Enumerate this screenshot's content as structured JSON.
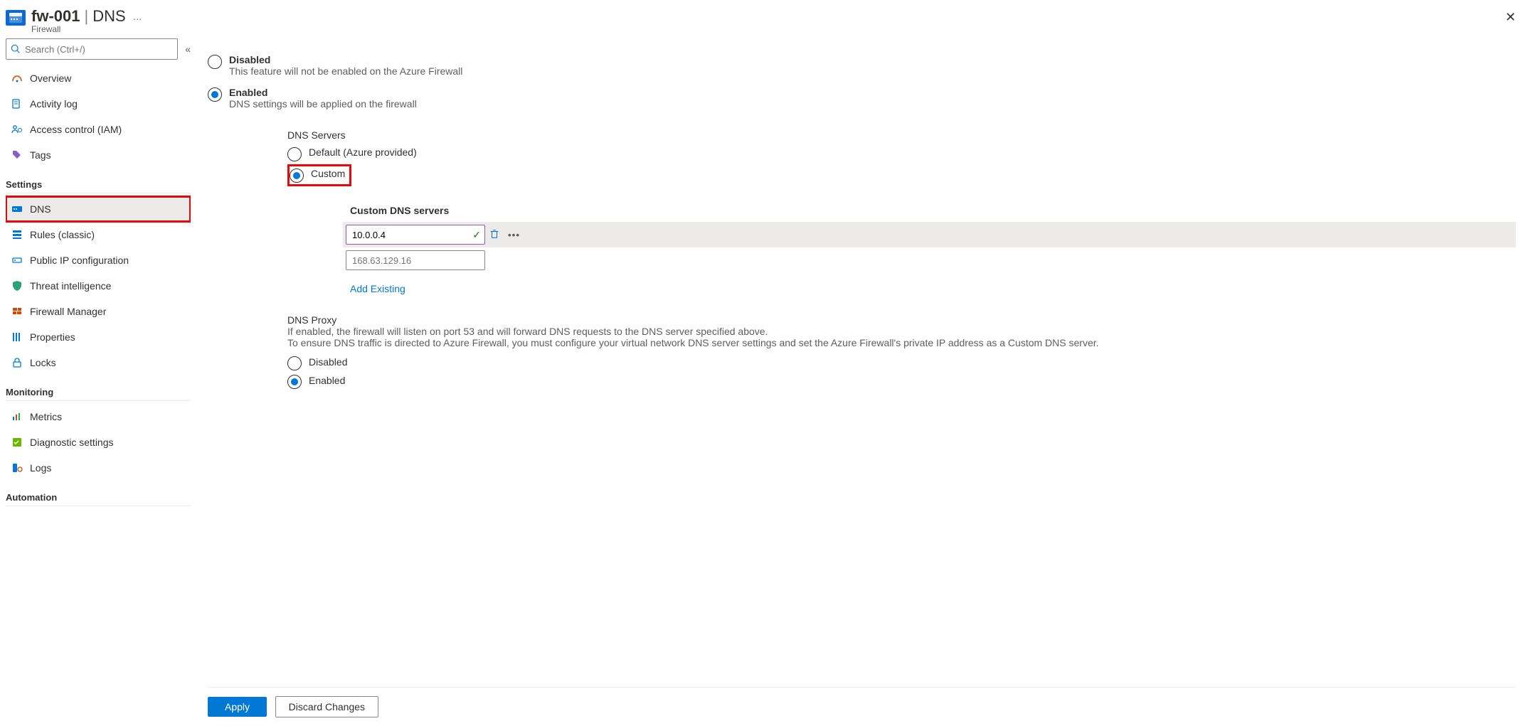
{
  "header": {
    "resource_name": "fw-001",
    "section": "DNS",
    "resource_type": "Firewall",
    "more": "…"
  },
  "search": {
    "placeholder": "Search (Ctrl+/)"
  },
  "nav": {
    "items_top": [
      {
        "label": "Overview"
      },
      {
        "label": "Activity log"
      },
      {
        "label": "Access control (IAM)"
      },
      {
        "label": "Tags"
      }
    ],
    "settings_header": "Settings",
    "items_settings": [
      {
        "label": "DNS"
      },
      {
        "label": "Rules (classic)"
      },
      {
        "label": "Public IP configuration"
      },
      {
        "label": "Threat intelligence"
      },
      {
        "label": "Firewall Manager"
      },
      {
        "label": "Properties"
      },
      {
        "label": "Locks"
      }
    ],
    "monitoring_header": "Monitoring",
    "items_monitoring": [
      {
        "label": "Metrics"
      },
      {
        "label": "Diagnostic settings"
      },
      {
        "label": "Logs"
      }
    ],
    "automation_header": "Automation"
  },
  "dns": {
    "disabled_label": "Disabled",
    "disabled_desc": "This feature will not be enabled on the Azure Firewall",
    "enabled_label": "Enabled",
    "enabled_desc": "DNS settings will be applied on the firewall",
    "servers_label": "DNS Servers",
    "default_label": "Default (Azure provided)",
    "custom_label": "Custom",
    "custom_servers_label": "Custom DNS servers",
    "server1": "10.0.0.4",
    "server2_placeholder": "168.63.129.16",
    "add_existing": "Add Existing",
    "proxy_label": "DNS Proxy",
    "proxy_desc1": "If enabled, the firewall will listen on port 53 and will forward DNS requests to the DNS server specified above.",
    "proxy_desc2": "To ensure DNS traffic is directed to Azure Firewall, you must configure your virtual network DNS server settings and set the Azure Firewall's private IP address as a Custom DNS server.",
    "proxy_disabled": "Disabled",
    "proxy_enabled": "Enabled"
  },
  "footer": {
    "apply": "Apply",
    "discard": "Discard Changes"
  }
}
